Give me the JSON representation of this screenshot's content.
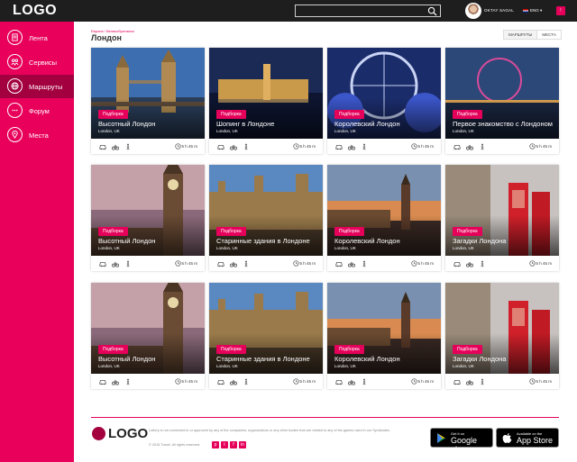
{
  "header": {
    "logo": "LOGO",
    "user_name": "OKTAY SAGAL",
    "lang": "ENG ▾",
    "notif": "!"
  },
  "search": {
    "placeholder": ""
  },
  "sidebar": {
    "items": [
      {
        "label": "Лента",
        "icon": "feed-icon"
      },
      {
        "label": "Сервисы",
        "icon": "services-icon"
      },
      {
        "label": "Маршруты",
        "icon": "globe-icon"
      },
      {
        "label": "Форум",
        "icon": "chat-icon"
      },
      {
        "label": "Места",
        "icon": "pin-icon"
      }
    ]
  },
  "page": {
    "breadcrumb": "Европа / Великобритания",
    "title": "Лондон",
    "tabs": [
      "МАРШРУТЫ",
      "МЕСТА"
    ]
  },
  "cards": [
    {
      "badge": "Подборка",
      "title": "Высотный Лондон",
      "location": "London, UK",
      "duration": "5 h 45 m",
      "scene": "bridge"
    },
    {
      "badge": "Подборка",
      "title": "Шопинг в Лондоне",
      "location": "London, UK",
      "duration": "5 h 45 m",
      "scene": "night"
    },
    {
      "badge": "Подборка",
      "title": "Королевский Лондон",
      "location": "London, UK",
      "duration": "5 h 45 m",
      "scene": "eye"
    },
    {
      "badge": "Подборка",
      "title": "Первое знакомство с Лондоном",
      "location": "London, UK",
      "duration": "5 h 45 m",
      "scene": "eyenight"
    },
    {
      "badge": "Подборка",
      "title": "Высотный Лондон",
      "location": "London, UK",
      "duration": "5 h 45 m",
      "scene": "bigben"
    },
    {
      "badge": "Подборка",
      "title": "Старинные здания в Лондоне",
      "location": "London, UK",
      "duration": "5 h 45 m",
      "scene": "parliament"
    },
    {
      "badge": "Подборка",
      "title": "Королевский Лондон",
      "location": "London, UK",
      "duration": "5 h 45 m",
      "scene": "sunset"
    },
    {
      "badge": "Подборка",
      "title": "Загадки Лондона",
      "location": "London, UK",
      "duration": "5 h 45 m",
      "scene": "phonebox"
    },
    {
      "badge": "Подборка",
      "title": "Высотный Лондон",
      "location": "London, UK",
      "duration": "5 h 45 m",
      "scene": "bigben"
    },
    {
      "badge": "Подборка",
      "title": "Старинные здания в Лондоне",
      "location": "London, UK",
      "duration": "5 h 45 m",
      "scene": "parliament"
    },
    {
      "badge": "Подборка",
      "title": "Королевский Лондон",
      "location": "London, UK",
      "duration": "5 h 45 m",
      "scene": "sunset"
    },
    {
      "badge": "Подборка",
      "title": "Загадки Лондона",
      "location": "London, UK",
      "duration": "5 h 45 m",
      "scene": "phonebox"
    }
  ],
  "footer": {
    "logo": "LOGO",
    "disclaimer": "Lottery is not connected to or approved by any of the companies, organizations or any other bodies that are related to any of the games used in our Syndicates.",
    "copyright": "© 2015 Travel. All rights reserved.",
    "socials": [
      "p",
      "t",
      "f",
      "in"
    ],
    "google_small": "Get it on",
    "google_big": "Google play",
    "apple_small": "Available on the",
    "apple_big": "App Store"
  },
  "colors": {
    "accent": "#e5005a",
    "sidebar": "#e8005a",
    "sidebar_active": "#a3003f",
    "topbar": "#1e1e1e"
  }
}
